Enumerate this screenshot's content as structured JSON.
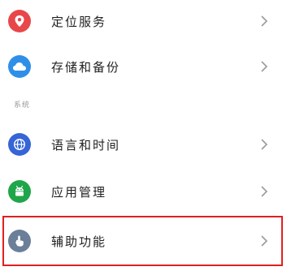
{
  "items_top": [
    {
      "label": "定位服务",
      "icon": "location-pin-icon",
      "icon_color": "#e8474a"
    },
    {
      "label": "存储和备份",
      "icon": "cloud-icon",
      "icon_color": "#2f8fe8"
    }
  ],
  "section": {
    "label": "系统"
  },
  "items_system": [
    {
      "label": "语言和时间",
      "icon": "globe-icon",
      "icon_color": "#3565d6"
    },
    {
      "label": "应用管理",
      "icon": "android-icon",
      "icon_color": "#1fa64a"
    },
    {
      "label": "辅助功能",
      "icon": "hand-pointer-icon",
      "icon_color": "#6b7f99"
    }
  ],
  "colors": {
    "highlight_border": "#e02020",
    "chevron": "#9a9a9a",
    "text": "#222222"
  }
}
